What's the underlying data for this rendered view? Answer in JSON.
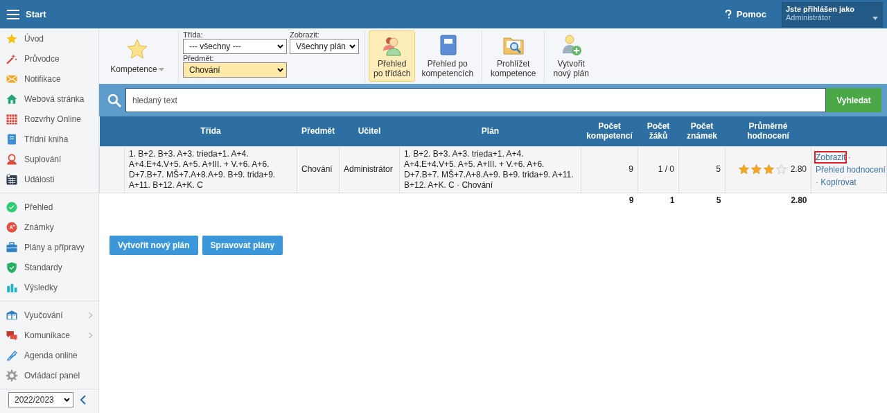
{
  "topbar": {
    "title": "Start",
    "help": "Pomoc",
    "user_label": "Jste přihlášen jako",
    "user_name": "Administrátor"
  },
  "sidebar": {
    "groups": [
      [
        {
          "label": "Úvod",
          "submenu": false
        },
        {
          "label": "Průvodce",
          "submenu": false
        },
        {
          "label": "Notifikace",
          "submenu": false
        },
        {
          "label": "Webová stránka",
          "submenu": false
        },
        {
          "label": "Rozvrhy Online",
          "submenu": false
        },
        {
          "label": "Třídní kniha",
          "submenu": false
        },
        {
          "label": "Suplování",
          "submenu": false
        },
        {
          "label": "Události",
          "submenu": false
        }
      ],
      [
        {
          "label": "Přehled",
          "submenu": false
        },
        {
          "label": "Známky",
          "submenu": false
        },
        {
          "label": "Plány a přípravy",
          "submenu": false
        },
        {
          "label": "Standardy",
          "submenu": false
        },
        {
          "label": "Výsledky",
          "submenu": false
        }
      ],
      [
        {
          "label": "Vyučování",
          "submenu": true
        },
        {
          "label": "Komunikace",
          "submenu": true
        },
        {
          "label": "Agenda online",
          "submenu": false
        },
        {
          "label": "Ovládací panel",
          "submenu": false
        }
      ]
    ],
    "year": "2022/2023"
  },
  "toolbar": {
    "menu": "Kompetence",
    "filters": [
      {
        "label": "Třída:",
        "value": "--- všechny ---",
        "highlighted": false
      },
      {
        "label": "Zobrazit:",
        "value": "Všechny plán",
        "highlighted": false
      },
      {
        "label": "Předmět:",
        "value": "Chování",
        "highlighted": true
      }
    ],
    "views": [
      {
        "label": "Přehled\npo třídách",
        "selected": true
      },
      {
        "label": "Přehled po\nkompetencích",
        "selected": false
      },
      {
        "label": "Prohlížet\nkompetence",
        "selected": false
      },
      {
        "label": "Vytvořit\nnový plán",
        "selected": false
      }
    ]
  },
  "search": {
    "placeholder": "hledaný text",
    "button": "Vyhledat"
  },
  "table": {
    "columns": [
      "Třída",
      "Předmět",
      "Učitel",
      "Plán",
      "Počet\nkompetencí",
      "Počet\nžáků",
      "Počet\nznámek",
      "Průměrné\nhodnocení"
    ],
    "rows": [
      {
        "trida": "1. B+2. B+3. A+3. trieda+1. A+4. A+4.E+4.V+5. A+5. A+III. + V.+6. A+6. D+7.B+7. MŠ+7.A+8.A+9. B+9. trida+9. A+11. B+12. A+K. C",
        "predmet": "Chování",
        "ucitel": "Administrátor",
        "plan": "1. B+2. B+3. A+3. trieda+1. A+4. A+4.E+4.V+5. A+5. A+III. + V.+6. A+6. D+7.B+7. MŠ+7.A+8.A+9. B+9. trida+9. A+11. B+12. A+K. C · Chování",
        "kompetence": "9",
        "zaci": "1 / 0",
        "znamky": "5",
        "stars": 3,
        "rating": "2.80",
        "actions": [
          {
            "label": "Zobrazit",
            "highlighted": true
          },
          {
            "label": "Přehled hodnocení",
            "highlighted": false
          },
          {
            "label": "Kopírovat",
            "highlighted": false
          }
        ],
        "separator": "·"
      }
    ],
    "totals": [
      "9",
      "1",
      "5",
      "2.80"
    ]
  },
  "buttons": [
    "Vytvořit nový plán",
    "Spravovat plány"
  ]
}
